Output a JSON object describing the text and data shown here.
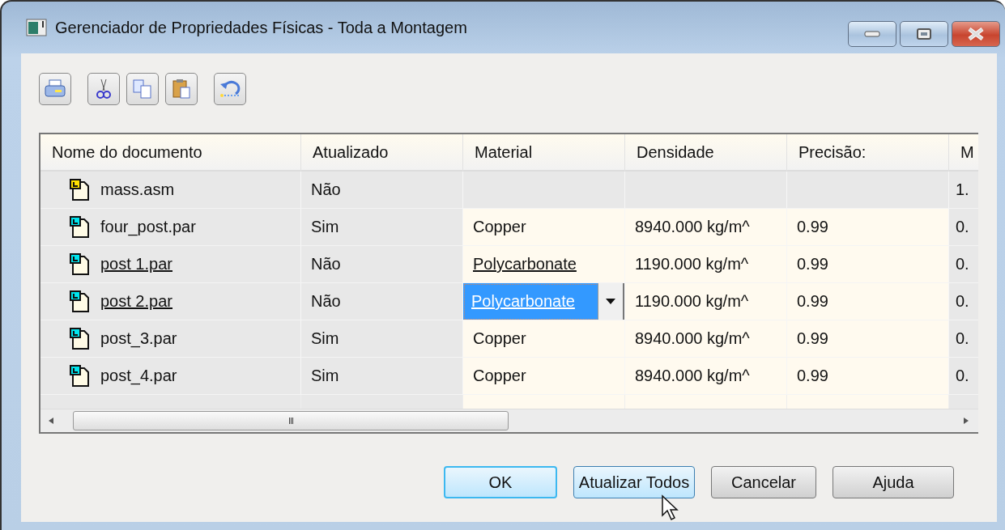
{
  "window": {
    "title": "Gerenciador de Propriedades Físicas - Toda a Montagem"
  },
  "toolbar": [
    {
      "kind": "print"
    },
    {
      "kind": "cut"
    },
    {
      "kind": "copy"
    },
    {
      "kind": "paste"
    },
    {
      "kind": "undo"
    }
  ],
  "table": {
    "columns": [
      "Nome do documento",
      "Atualizado",
      "Material",
      "Densidade",
      "Precisão:",
      "M"
    ],
    "rows": [
      {
        "kind": "assembly",
        "name": "mass.asm",
        "updated": "Não",
        "material": "",
        "density": "",
        "precision": "",
        "column_6": "1.",
        "changed": false,
        "selected": false
      },
      {
        "kind": "part",
        "name": "four_post.par",
        "updated": "Sim",
        "material": "Copper",
        "density": "8940.000 kg/m^",
        "precision": "0.99",
        "column_6": "0.",
        "changed": false,
        "selected": false
      },
      {
        "kind": "part",
        "name": "post 1.par",
        "updated": "Não",
        "material": "Polycarbonate",
        "density": "1190.000 kg/m^",
        "precision": "0.99",
        "column_6": "0.",
        "changed": true,
        "selected": false
      },
      {
        "kind": "part",
        "name": "post 2.par",
        "updated": "Não",
        "material": "Polycarbonate",
        "density": "1190.000 kg/m^",
        "precision": "0.99",
        "column_6": "0.",
        "changed": true,
        "selected": true
      },
      {
        "kind": "part",
        "name": "post_3.par",
        "updated": "Sim",
        "material": "Copper",
        "density": "8940.000 kg/m^",
        "precision": "0.99",
        "column_6": "0.",
        "changed": false,
        "selected": false
      },
      {
        "kind": "part",
        "name": "post_4.par",
        "updated": "Sim",
        "material": "Copper",
        "density": "8940.000 kg/m^",
        "precision": "0.99",
        "column_6": "0.",
        "changed": false,
        "selected": false
      }
    ],
    "scrollbar_label": "III"
  },
  "buttons": [
    {
      "label": "OK",
      "default": true,
      "hovered": false
    },
    {
      "label": "Atualizar Todos",
      "default": false,
      "hovered": true
    },
    {
      "label": "Cancelar",
      "default": false,
      "hovered": false
    },
    {
      "label": "Ajuda",
      "default": false,
      "hovered": false
    }
  ]
}
